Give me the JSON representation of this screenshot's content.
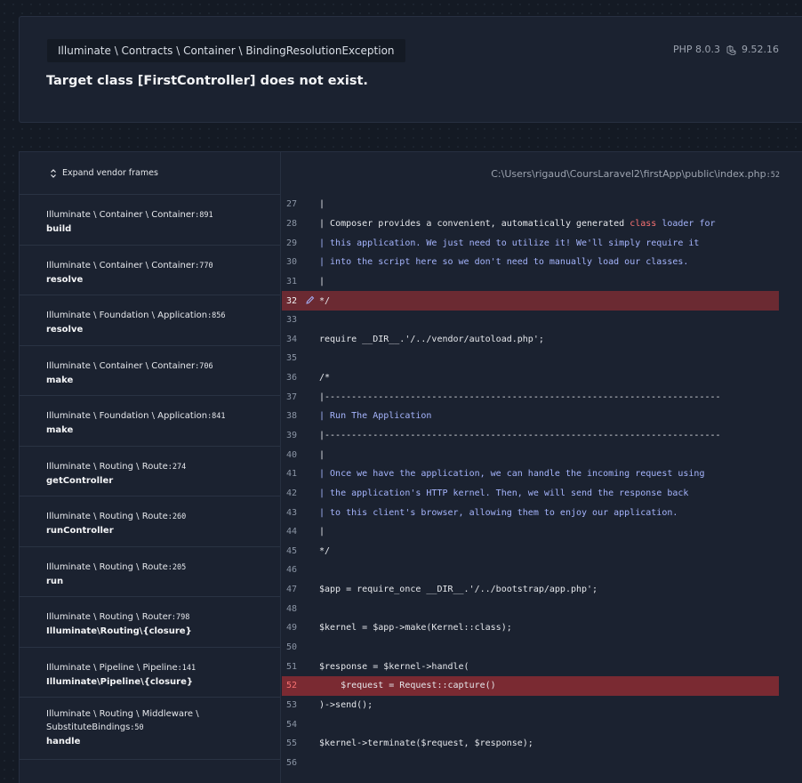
{
  "header": {
    "exception_class": "Illuminate \\ Contracts \\ Container \\ BindingResolutionException",
    "php_version": "PHP 8.0.3",
    "laravel_version": "9.52.16",
    "message": "Target class [FirstController] does not exist."
  },
  "frames": {
    "expand_label": "Expand vendor frames",
    "items": [
      {
        "class": "Illuminate \\ Container \\ Container",
        "line": ":891",
        "method": "build"
      },
      {
        "class": "Illuminate \\ Container \\ Container",
        "line": ":770",
        "method": "resolve"
      },
      {
        "class": "Illuminate \\ Foundation \\ Application",
        "line": ":856",
        "method": "resolve"
      },
      {
        "class": "Illuminate \\ Container \\ Container",
        "line": ":706",
        "method": "make"
      },
      {
        "class": "Illuminate \\ Foundation \\ Application",
        "line": ":841",
        "method": "make"
      },
      {
        "class": "Illuminate \\ Routing \\ Route",
        "line": ":274",
        "method": "getController"
      },
      {
        "class": "Illuminate \\ Routing \\ Route",
        "line": ":260",
        "method": "runController"
      },
      {
        "class": "Illuminate \\ Routing \\ Route",
        "line": ":205",
        "method": "run"
      },
      {
        "class": "Illuminate \\ Routing \\ Router",
        "line": ":798",
        "method": "Illuminate\\Routing\\{closure}"
      },
      {
        "class": "Illuminate \\ Pipeline \\ Pipeline",
        "line": ":141",
        "method": "Illuminate\\Pipeline\\{closure}"
      },
      {
        "class": "Illuminate \\ Routing \\ Middleware \\",
        "class2": "SubstituteBindings",
        "line": ":50",
        "method": "handle"
      }
    ]
  },
  "code": {
    "file_path": "C:\\Users\\rigaud\\CoursLaravel2\\firstApp\\public\\index.php",
    "file_line": ":52",
    "lines": [
      {
        "n": "27",
        "text": "|"
      },
      {
        "n": "28",
        "text": "| Composer provides a convenient, automatically generated class loader for"
      },
      {
        "n": "29",
        "text": "| this application. We just need to utilize it! We'll simply require it"
      },
      {
        "n": "30",
        "text": "| into the script here so we don't need to manually load our classes."
      },
      {
        "n": "31",
        "text": "|"
      },
      {
        "n": "32",
        "text": "*/"
      },
      {
        "n": "33",
        "text": ""
      },
      {
        "n": "34",
        "text": "require __DIR__.'/../vendor/autoload.php';"
      },
      {
        "n": "35",
        "text": ""
      },
      {
        "n": "36",
        "text": "/*"
      },
      {
        "n": "37",
        "text": "|--------------------------------------------------------------------------"
      },
      {
        "n": "38",
        "text": "| Run The Application"
      },
      {
        "n": "39",
        "text": "|--------------------------------------------------------------------------"
      },
      {
        "n": "40",
        "text": "|"
      },
      {
        "n": "41",
        "text": "| Once we have the application, we can handle the incoming request using"
      },
      {
        "n": "42",
        "text": "| the application's HTTP kernel. Then, we will send the response back"
      },
      {
        "n": "43",
        "text": "| to this client's browser, allowing them to enjoy our application."
      },
      {
        "n": "44",
        "text": "|"
      },
      {
        "n": "45",
        "text": "*/"
      },
      {
        "n": "46",
        "text": ""
      },
      {
        "n": "47",
        "text": "$app = require_once __DIR__.'/../bootstrap/app.php';"
      },
      {
        "n": "48",
        "text": ""
      },
      {
        "n": "49",
        "text": "$kernel = $app->make(Kernel::class);"
      },
      {
        "n": "50",
        "text": ""
      },
      {
        "n": "51",
        "text": "$response = $kernel->handle("
      },
      {
        "n": "52",
        "text": "    $request = Request::capture()"
      },
      {
        "n": "53",
        "text": ")->send();"
      },
      {
        "n": "54",
        "text": ""
      },
      {
        "n": "55",
        "text": "$kernel->terminate($request, $response);"
      },
      {
        "n": "56",
        "text": ""
      }
    ]
  }
}
